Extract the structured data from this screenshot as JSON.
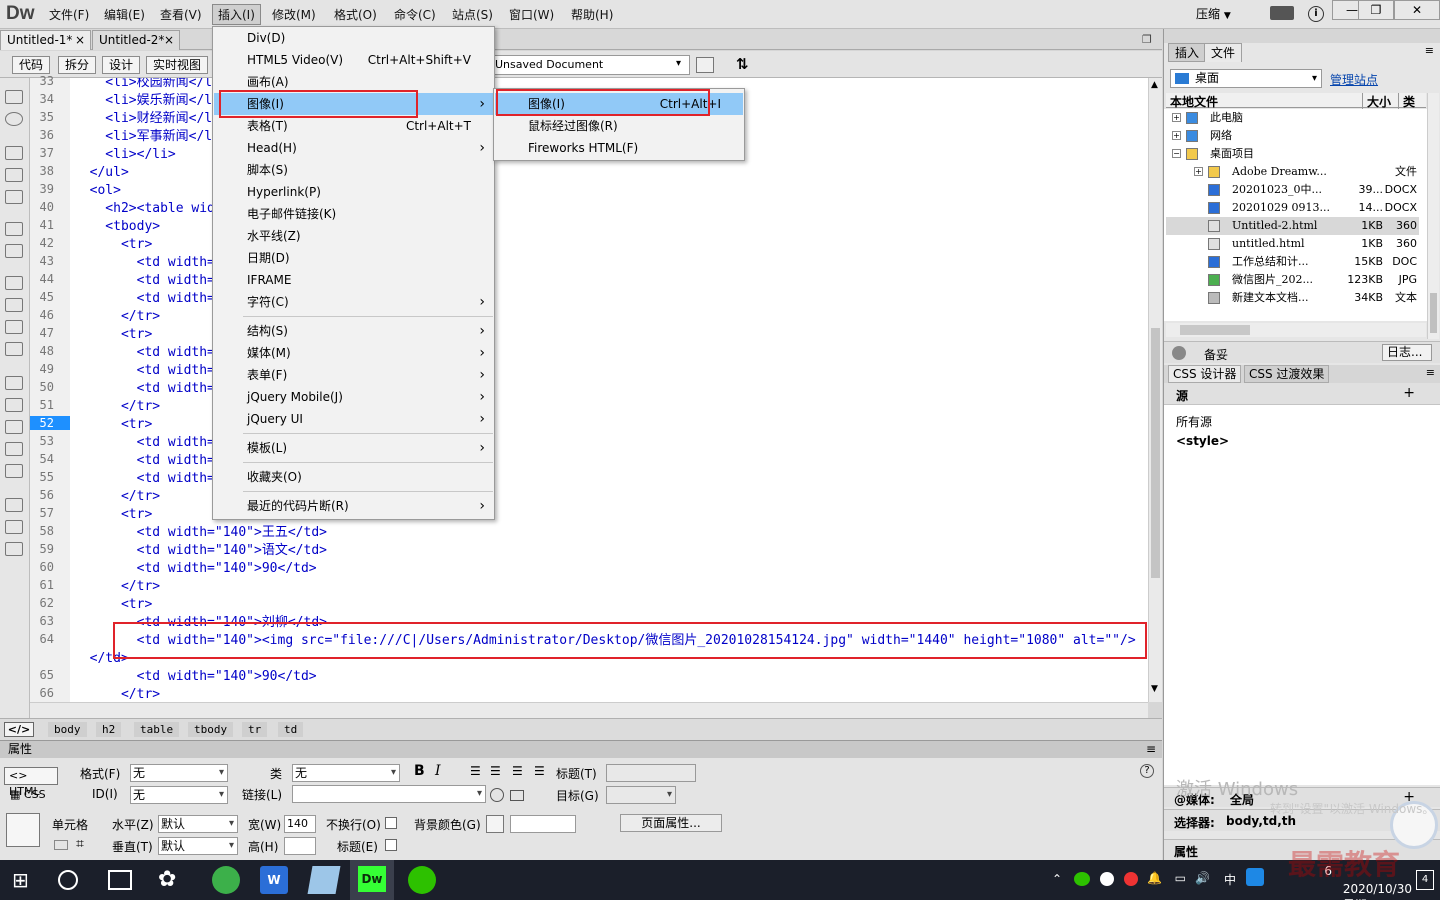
{
  "app": {
    "logo": "Dw"
  },
  "menubar": {
    "items": [
      "文件(F)",
      "编辑(E)",
      "查看(V)",
      "插入(I)",
      "修改(M)",
      "格式(O)",
      "命令(C)",
      "站点(S)",
      "窗口(W)",
      "帮助(H)"
    ],
    "active": "插入(I)",
    "workspace": "压缩"
  },
  "doc_tabs": [
    "Untitled-1*",
    "Untitled-2*"
  ],
  "toolbar": {
    "views": [
      "代码",
      "拆分",
      "设计",
      "实时视图"
    ],
    "title_value": "Unsaved Document"
  },
  "insert_menu": {
    "items": [
      {
        "label": "Div(D)"
      },
      {
        "label": "HTML5 Video(V)",
        "shortcut": "Ctrl+Alt+Shift+V"
      },
      {
        "label": "画布(A)"
      },
      {
        "label": "图像(I)",
        "submenu": true,
        "highlighted": true
      },
      {
        "label": "表格(T)",
        "shortcut": "Ctrl+Alt+T"
      },
      {
        "label": "Head(H)",
        "submenu": true
      },
      {
        "label": "脚本(S)"
      },
      {
        "label": "Hyperlink(P)"
      },
      {
        "label": "电子邮件链接(K)"
      },
      {
        "label": "水平线(Z)"
      },
      {
        "label": "日期(D)"
      },
      {
        "label": "IFRAME"
      },
      {
        "label": "字符(C)",
        "submenu": true
      },
      {
        "label": "结构(S)",
        "submenu": true
      },
      {
        "label": "媒体(M)",
        "submenu": true
      },
      {
        "label": "表单(F)",
        "submenu": true
      },
      {
        "label": "jQuery Mobile(J)",
        "submenu": true
      },
      {
        "label": "jQuery UI",
        "submenu": true
      },
      {
        "label": "模板(L)",
        "submenu": true
      },
      {
        "label": "收藏夹(O)"
      },
      {
        "label": "最近的代码片断(R)",
        "submenu": true
      }
    ]
  },
  "image_submenu": {
    "items": [
      {
        "label": "图像(I)",
        "shortcut": "Ctrl+Alt+I",
        "highlighted": true
      },
      {
        "label": "鼠标经过图像(R)"
      },
      {
        "label": "Fireworks HTML(F)"
      }
    ]
  },
  "code": {
    "current_line": 52,
    "line_numbers": [
      33,
      34,
      35,
      36,
      37,
      38,
      39,
      40,
      41,
      42,
      43,
      44,
      45,
      46,
      47,
      48,
      49,
      50,
      51,
      52,
      53,
      54,
      55,
      56,
      57,
      58,
      59,
      60,
      61,
      62,
      63,
      64,
      65,
      66
    ],
    "lines": [
      "    <li>校园新闻</li>",
      "    <li>娱乐新闻</li>",
      "    <li>财经新闻</li>",
      "    <li>军事新闻</li>",
      "    <li></li>",
      "  </ul>",
      "  <ol>",
      "    <h2><table width=\"200\" border=\"1\">",
      "    <tbody>",
      "      <tr>",
      "        <td width=\"140\">",
      "        <td width=\"140\">",
      "        <td width=\"140\">",
      "      </tr>",
      "      <tr>",
      "        <td width=\"140\">",
      "        <td width=\"140\">",
      "        <td width=\"140\">",
      "      </tr>",
      "      <tr>",
      "        <td width=\"140\">",
      "        <td width=\"140\">",
      "        <td width=\"140\">",
      "      </tr>",
      "      <tr>",
      "        <td width=\"140\">王五</td>",
      "        <td width=\"140\">语文</td>",
      "        <td width=\"140\">90</td>",
      "      </tr>",
      "      <tr>",
      "        <td width=\"140\">刘柳</td>",
      "        <td width=\"140\"><img src=\"file:///C|/Users/Administrator/Desktop/微信图片_20201028154124.jpg\" width=\"1440\" height=\"1080\" alt=\"\"/>",
      "  </td>",
      "        <td width=\"140\">90</td>",
      "      </tr>"
    ]
  },
  "tag_selector": [
    "body",
    "h2",
    "table",
    "tbody",
    "tr",
    "td"
  ],
  "properties": {
    "title": "属性",
    "html_btn": "HTML",
    "css_btn": "CSS",
    "format_label": "格式(F)",
    "format_value": "无",
    "class_label": "类",
    "class_value": "无",
    "id_label": "ID(I)",
    "id_value": "无",
    "link_label": "链接(L)",
    "heading_label": "标题(T)",
    "target_label": "目标(G)",
    "cell_label": "单元格",
    "horz_label": "水平(Z)",
    "horz_value": "默认",
    "vert_label": "垂直(T)",
    "vert_value": "默认",
    "width_label": "宽(W)",
    "width_value": "140",
    "height_label": "高(H)",
    "nowrap_label": "不换行(O)",
    "header_label": "标题(E)",
    "bg_label": "背景颜色(G)",
    "page_props": "页面属性..."
  },
  "files_panel": {
    "tabs": [
      "插入",
      "文件"
    ],
    "site": "桌面",
    "manage": "管理站点",
    "columns": [
      "本地文件",
      "大小",
      "类型"
    ],
    "rows": [
      {
        "name": "此电脑",
        "size": "",
        "type": "",
        "indent": 1,
        "icon": "computer-icon"
      },
      {
        "name": "网络",
        "size": "",
        "type": "",
        "indent": 1,
        "icon": "network-icon"
      },
      {
        "name": "桌面项目",
        "size": "",
        "type": "",
        "indent": 1,
        "icon": "folder-icon"
      },
      {
        "name": "Adobe Dreamw...",
        "size": "",
        "type": "文件",
        "indent": 2,
        "icon": "folder-icon"
      },
      {
        "name": "20201023_0中...",
        "size": "39...",
        "type": "DOCX",
        "indent": 2,
        "icon": "word-icon"
      },
      {
        "name": "20201029 0913...",
        "size": "14...",
        "type": "DOCX",
        "indent": 2,
        "icon": "word-icon"
      },
      {
        "name": "Untitled-2.html",
        "size": "1KB",
        "type": "360",
        "indent": 2,
        "icon": "html-icon",
        "selected": true
      },
      {
        "name": "untitled.html",
        "size": "1KB",
        "type": "360",
        "indent": 2,
        "icon": "html-icon"
      },
      {
        "name": "工作总结和计...",
        "size": "15KB",
        "type": "DOC",
        "indent": 2,
        "icon": "word-icon"
      },
      {
        "name": "微信图片_202...",
        "size": "123KB",
        "type": "JPG",
        "indent": 2,
        "icon": "image-icon"
      },
      {
        "name": "新建文本文档...",
        "size": "34KB",
        "type": "文本",
        "indent": 2,
        "icon": "text-icon"
      }
    ],
    "footer_left": "备妥",
    "footer_right": "日志..."
  },
  "css_panel": {
    "tabs": [
      "CSS 设计器",
      "CSS 过渡效果"
    ],
    "source_label": "源",
    "all_sources": "所有源",
    "style": "<style>",
    "media_label": "@媒体:",
    "media_value": "全局",
    "selector_label": "选择器:",
    "selector_value": "body,td,th",
    "props_label": "属性"
  },
  "watermark": {
    "line1": "激活 Windows",
    "line2": "转到\"设置\"以激活 Windows。"
  },
  "brand": "最需教育",
  "taskbar": {
    "date": "2020/10/30 星期五",
    "time": "6",
    "ime": "中",
    "notif": "4"
  }
}
